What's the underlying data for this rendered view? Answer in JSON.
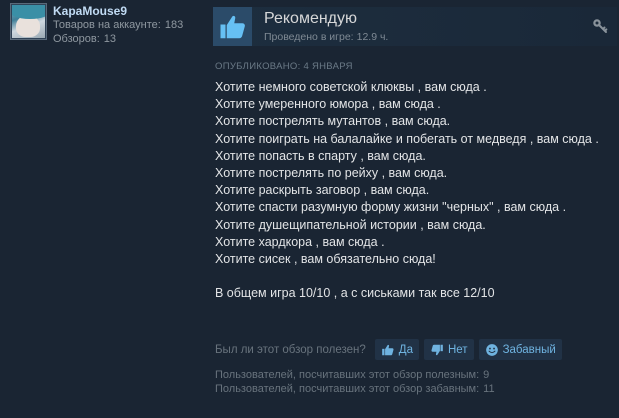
{
  "author": {
    "name": "KapaMouse9",
    "products_label": "Товаров на аккаунте:",
    "products_count": "183",
    "reviews_label": "Обзоров:",
    "reviews_count": "13"
  },
  "header": {
    "title": "Рекомендую",
    "hours_label": "Проведено в игре:",
    "hours_value": "12.9 ч.",
    "thumb_icon": "thumbs-up-icon",
    "key_icon": "key-icon"
  },
  "posted": "ОПУБЛИКОВАНО: 4 ЯНВАРЯ",
  "review": {
    "lines": [
      "Хотите немного советской клюквы , вам сюда .",
      "Хотите умеренного юмора , вам сюда .",
      "Хотите пострелять мутантов , вам сюда.",
      "Хотите поиграть на балалайке и побегать от медведя , вам сюда .",
      "Хотите попасть в спарту , вам сюда.",
      "Хотите пострелять по рейху , вам сюда.",
      "Хотите раскрыть заговор , вам сюда.",
      "Хотите спасти разумную форму жизни \"черных\" , вам сюда .",
      "Хотите душещипательной истории , вам сюда.",
      "Хотите хардкора , вам сюда .",
      "Хотите сисек , вам обязательно сюда!"
    ],
    "summary": "В общем игра 10/10 , а с сиськами так все 12/10"
  },
  "rating": {
    "question": "Был ли этот обзор полезен?",
    "yes_label": "Да",
    "no_label": "Нет",
    "funny_label": "Забавный"
  },
  "stats": {
    "helpful_label": "Пользователей, посчитавших этот обзор полезным:",
    "helpful_value": "9",
    "funny_label": "Пользователей, посчитавших этот обзор забавным:",
    "funny_value": "11"
  },
  "colors": {
    "background": "#1a2533",
    "author_name": "#c1dbf4",
    "button_text": "#6fb3e0",
    "muted_text": "#68737d"
  }
}
